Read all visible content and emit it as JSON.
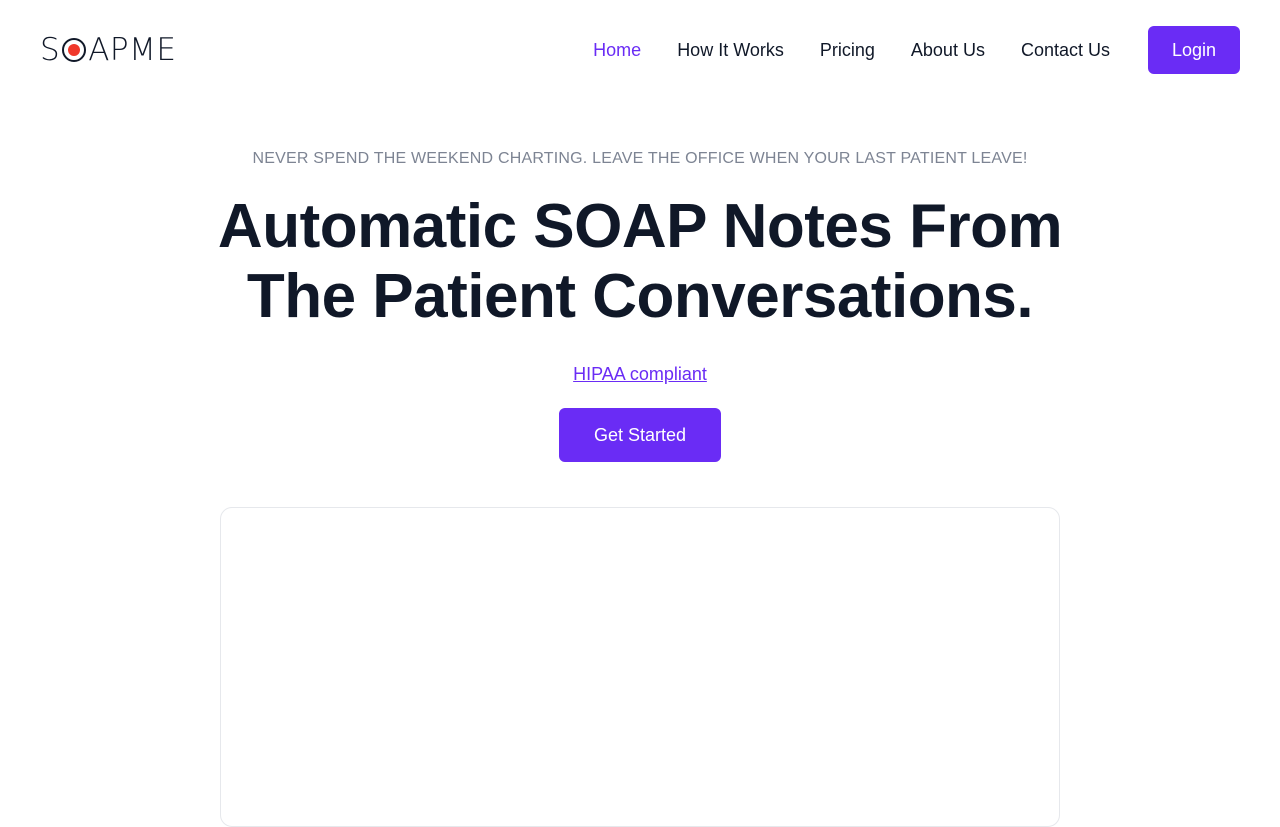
{
  "brand": {
    "logo_prefix": "S",
    "logo_suffix": "APME",
    "accent_color": "#6a2cf5",
    "logo_dot_color": "#f0382b"
  },
  "nav": {
    "items": [
      {
        "label": "Home",
        "active": true
      },
      {
        "label": "How It Works",
        "active": false
      },
      {
        "label": "Pricing",
        "active": false
      },
      {
        "label": "About Us",
        "active": false
      },
      {
        "label": "Contact Us",
        "active": false
      }
    ],
    "login_label": "Login"
  },
  "hero": {
    "eyebrow": "NEVER SPEND THE WEEKEND CHARTING. LEAVE THE OFFICE WHEN YOUR LAST PATIENT LEAVE!",
    "headline": "Automatic SOAP Notes From The Patient Conversations.",
    "hipaa_link": "HIPAA compliant",
    "cta_label": "Get Started"
  },
  "icons": {
    "logo_mark": "record-dot-icon"
  }
}
